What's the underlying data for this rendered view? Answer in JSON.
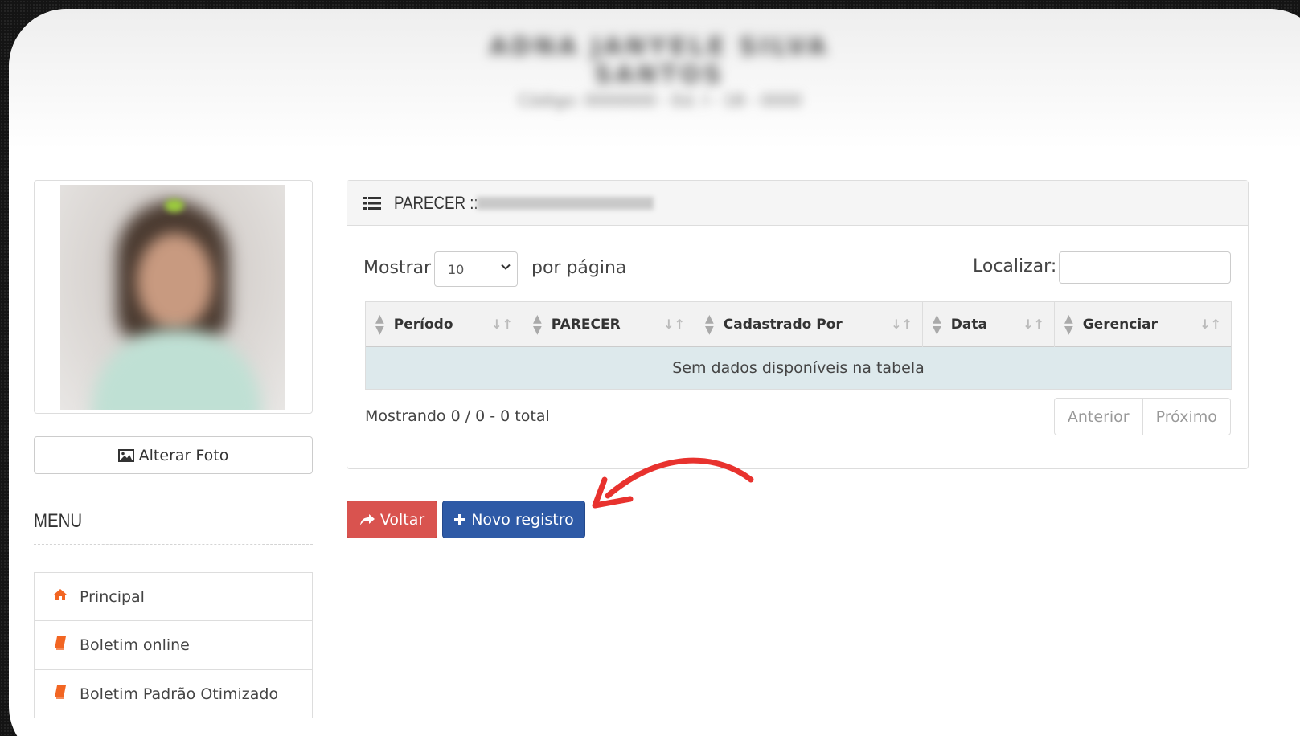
{
  "header": {
    "name": "ADNA JANYELE SILVA SANTOS",
    "subtitle": "Código: 0000000 - Ed. I - 1B - 0000"
  },
  "profile": {
    "change_photo_label": "Alterar Foto"
  },
  "menu": {
    "title": "MENU",
    "items": [
      {
        "label": "Principal",
        "icon": "home-icon"
      },
      {
        "label": "Boletim online",
        "icon": "book-icon"
      },
      {
        "label": "Boletim Padrão Otimizado",
        "icon": "book-icon"
      }
    ]
  },
  "panel": {
    "title": "PARECER ::",
    "controls": {
      "show_label": "Mostrar",
      "page_size": "10",
      "per_page_label": "por página",
      "search_label": "Localizar:",
      "search_value": ""
    },
    "columns": [
      "Período",
      "PARECER",
      "Cadastrado Por",
      "Data",
      "Gerenciar"
    ],
    "empty_message": "Sem dados disponíveis na tabela",
    "info": "Mostrando 0 / 0 - 0 total",
    "pager": {
      "prev": "Anterior",
      "next": "Próximo"
    }
  },
  "actions": {
    "back": "Voltar",
    "new": "Novo registro"
  },
  "colors": {
    "danger": "#d9534f",
    "primary": "#2e5aa6",
    "accent": "#f26522",
    "annotation": "#e8322e"
  }
}
